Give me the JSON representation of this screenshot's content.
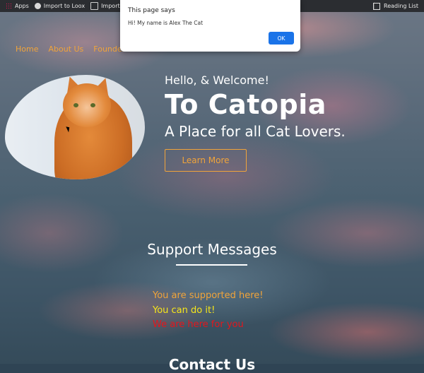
{
  "browser": {
    "bookmarks": [
      {
        "label": "Apps",
        "icon": "apps-grid-icon"
      },
      {
        "label": "Import to Loox",
        "icon": "globe-icon"
      },
      {
        "label": "Imported From",
        "icon": "folder-icon"
      }
    ],
    "reading_list": "Reading List"
  },
  "dialog": {
    "title": "This page says",
    "message": "Hi! My name is Alex The Cat",
    "ok_label": "OK"
  },
  "nav": {
    "items": [
      "Home",
      "About Us",
      "Founder P"
    ]
  },
  "hero": {
    "greeting": "Hello, & Welcome!",
    "title": "To Catopia",
    "tagline": "A Place for all Cat Lovers.",
    "cta": "Learn More"
  },
  "support": {
    "title": "Support Messages",
    "messages": [
      {
        "text": "You are supported here!",
        "color": "#f1a43a"
      },
      {
        "text": "You can do it!",
        "color": "#f6e71a"
      },
      {
        "text": "We are here for you",
        "color": "#e4161c"
      }
    ]
  },
  "contact": {
    "title": "Contact Us"
  },
  "colors": {
    "accent": "#f1a43a",
    "dialog_button": "#1a73e8"
  }
}
